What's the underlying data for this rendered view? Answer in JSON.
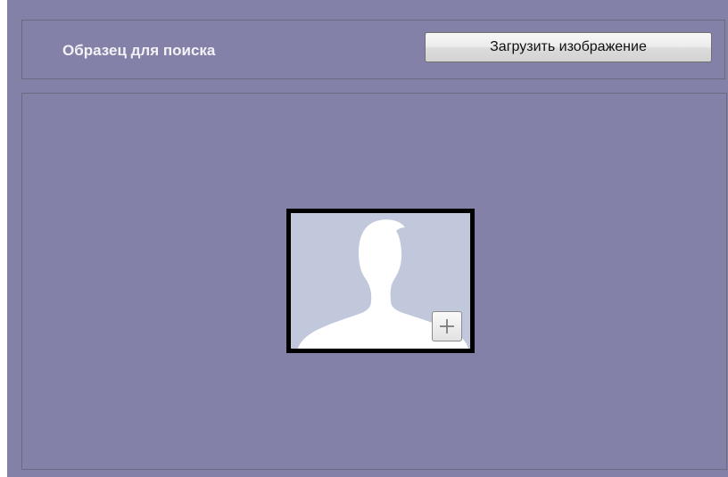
{
  "header": {
    "title": "Образец для поиска",
    "upload_button_label": "Загрузить изображение"
  },
  "preview": {
    "placeholder_icon": "person-silhouette-icon",
    "add_icon": "plus-icon"
  },
  "colors": {
    "panel_background": "#8481a8",
    "group_border": "#6a6a80",
    "photo_background": "#c2c8dc",
    "photo_border": "#000000"
  }
}
